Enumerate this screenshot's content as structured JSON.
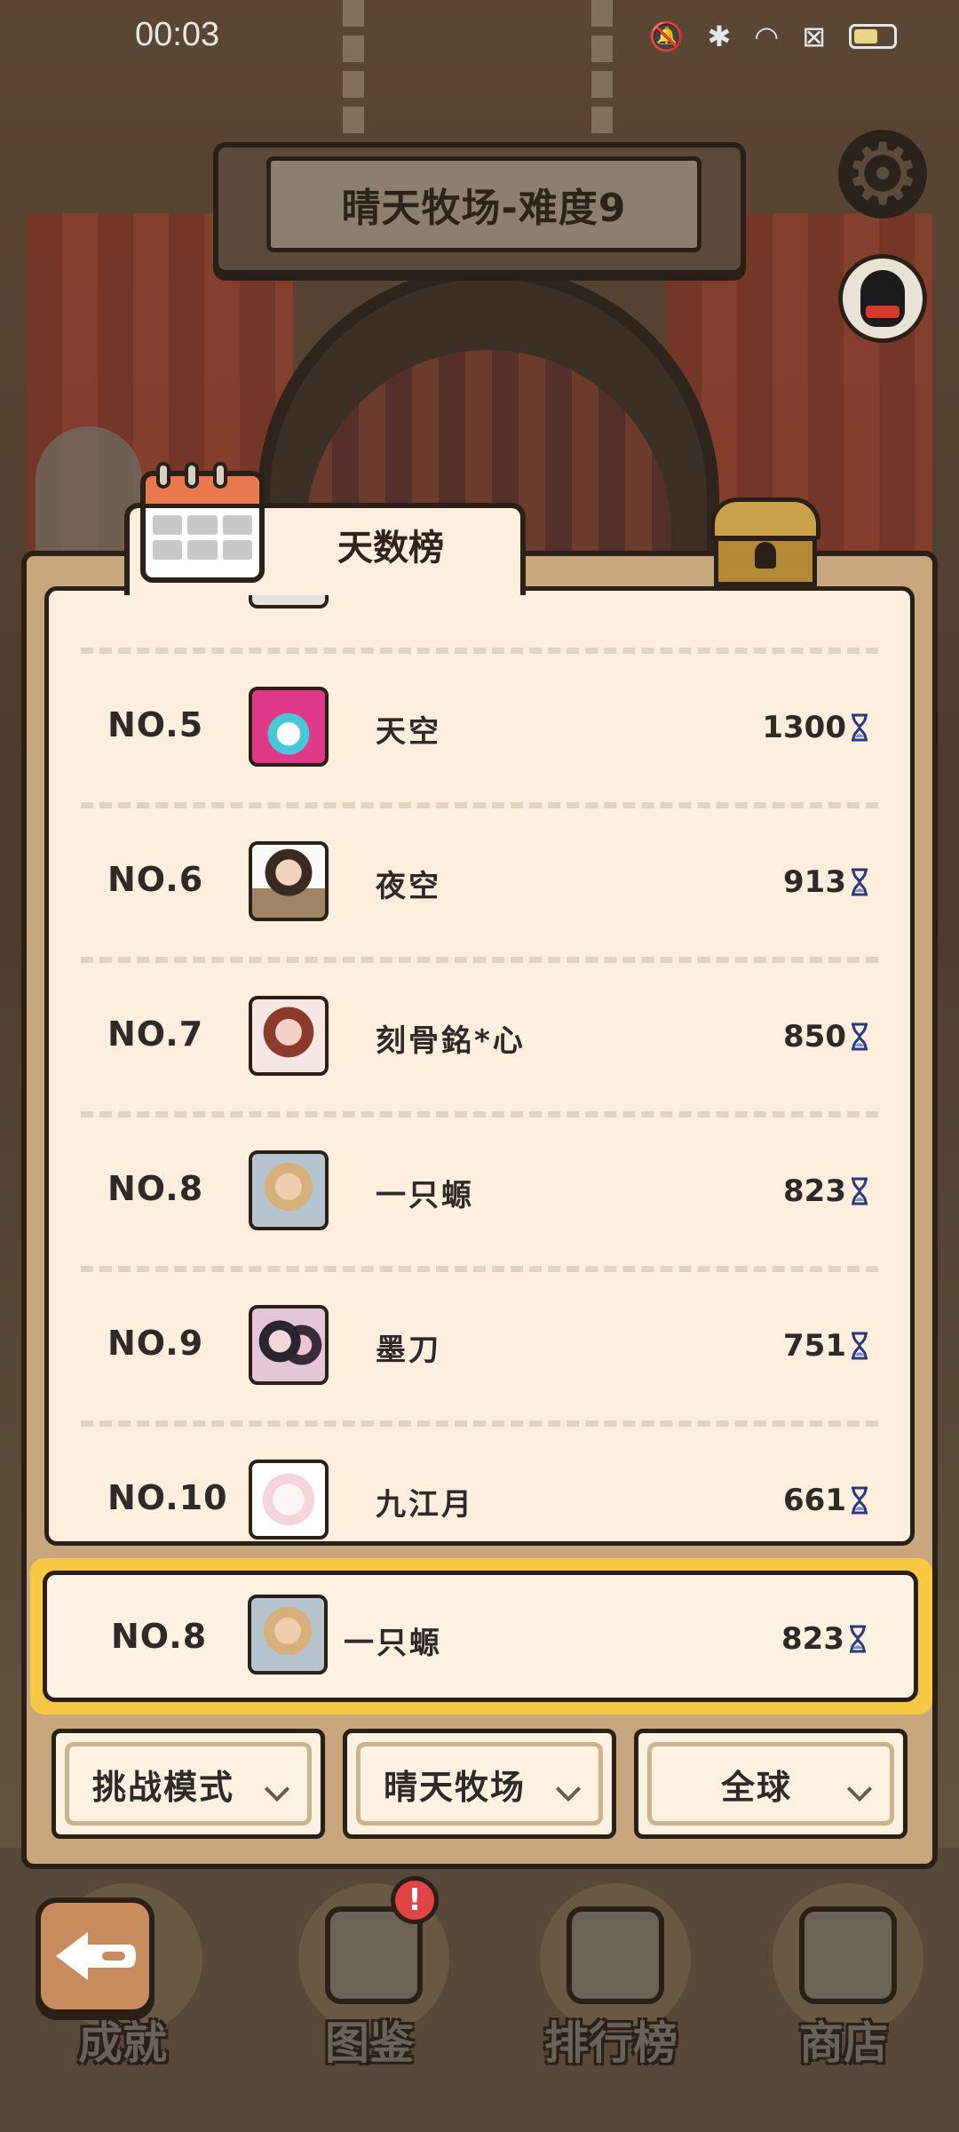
{
  "status_bar": {
    "time": "00:03"
  },
  "title": "晴天牧场-难度9",
  "tab_label": "天数榜",
  "leaderboard": [
    {
      "rank": "NO.5",
      "name": "天空",
      "score": "1300",
      "avatar": "av-5"
    },
    {
      "rank": "NO.6",
      "name": "夜空",
      "score": "913",
      "avatar": "av-6"
    },
    {
      "rank": "NO.7",
      "name": "刻骨銘*心",
      "score": "850",
      "avatar": "av-7"
    },
    {
      "rank": "NO.8",
      "name": "一只螈",
      "score": "823",
      "avatar": "av-8"
    },
    {
      "rank": "NO.9",
      "name": "墨刀",
      "score": "751",
      "avatar": "av-9"
    },
    {
      "rank": "NO.10",
      "name": "九江月",
      "score": "661",
      "avatar": "av-10"
    }
  ],
  "my_entry": {
    "rank": "NO.8",
    "name": "一只螈",
    "score": "823"
  },
  "filters": {
    "mode": "挑战模式",
    "map": "晴天牧场",
    "region": "全球"
  },
  "bottom_nav": {
    "achievements": "成就",
    "collection": "图鉴",
    "leaderboard": "排行榜",
    "shop": "商店",
    "badge": "!"
  },
  "colors": {
    "panel": "#c9a77e",
    "list_bg": "#fdeedd",
    "highlight": "#f7c844",
    "outline": "#2a2018"
  }
}
